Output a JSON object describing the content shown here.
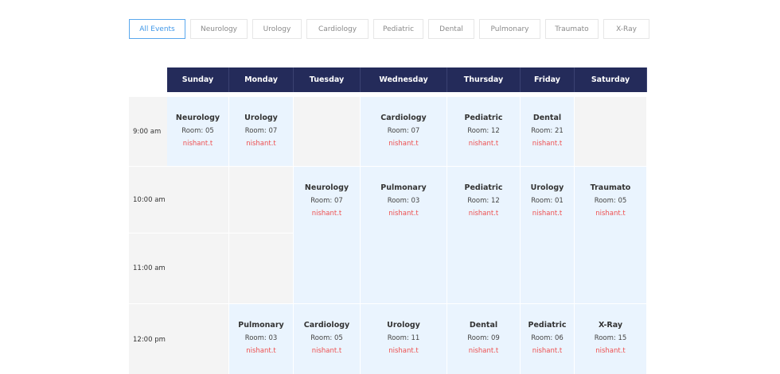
{
  "filters": [
    {
      "label": "All Events",
      "active": true,
      "width": 71
    },
    {
      "label": "Neurology",
      "active": false,
      "width": 72
    },
    {
      "label": "Urology",
      "active": false,
      "width": 62
    },
    {
      "label": "Cardiology",
      "active": false,
      "width": 78
    },
    {
      "label": "Pediatric",
      "active": false,
      "width": 63
    },
    {
      "label": "Dental",
      "active": false,
      "width": 58
    },
    {
      "label": "Pulmonary",
      "active": false,
      "width": 77
    },
    {
      "label": "Traumato",
      "active": false,
      "width": 67
    },
    {
      "label": "X-Ray",
      "active": false,
      "width": 58
    }
  ],
  "days": [
    "Sunday",
    "Monday",
    "Tuesday",
    "Wednesday",
    "Thursday",
    "Friday",
    "Saturday"
  ],
  "times": [
    "9:00 am",
    "10:00 am",
    "11:00 am",
    "12:00 pm"
  ],
  "events": {
    "sun_9": {
      "name": "Neurology",
      "room": "Room: 05",
      "user": "nishant.t"
    },
    "mon_9": {
      "name": "Urology",
      "room": "Room: 07",
      "user": "nishant.t"
    },
    "wed_9": {
      "name": "Cardiology",
      "room": "Room: 07",
      "user": "nishant.t"
    },
    "thu_9": {
      "name": "Pediatric",
      "room": "Room: 12",
      "user": "nishant.t"
    },
    "fri_9": {
      "name": "Dental",
      "room": "Room: 21",
      "user": "nishant.t"
    },
    "tue_10": {
      "name": "Neurology",
      "room": "Room: 07",
      "user": "nishant.t"
    },
    "wed_10": {
      "name": "Pulmonary",
      "room": "Room: 03",
      "user": "nishant.t"
    },
    "thu_10": {
      "name": "Pediatric",
      "room": "Room: 12",
      "user": "nishant.t"
    },
    "fri_10": {
      "name": "Urology",
      "room": "Room: 01",
      "user": "nishant.t"
    },
    "sat_10": {
      "name": "Traumato",
      "room": "Room: 05",
      "user": "nishant.t"
    },
    "mon_12": {
      "name": "Pulmonary",
      "room": "Room: 03",
      "user": "nishant.t"
    },
    "tue_12": {
      "name": "Cardiology",
      "room": "Room: 05",
      "user": "nishant.t"
    },
    "wed_12": {
      "name": "Urology",
      "room": "Room: 11",
      "user": "nishant.t"
    },
    "thu_12": {
      "name": "Dental",
      "room": "Room: 09",
      "user": "nishant.t"
    },
    "fri_12": {
      "name": "Pediatric",
      "room": "Room: 06",
      "user": "nishant.t"
    },
    "sat_12": {
      "name": "X-Ray",
      "room": "Room: 15",
      "user": "nishant.t"
    }
  },
  "colors": {
    "header_bg": "#242b5a",
    "event_bg": "#eaf4fe",
    "empty_bg": "#f4f4f4",
    "user_link": "#ee5050",
    "active_filter": "#3f97e8"
  }
}
